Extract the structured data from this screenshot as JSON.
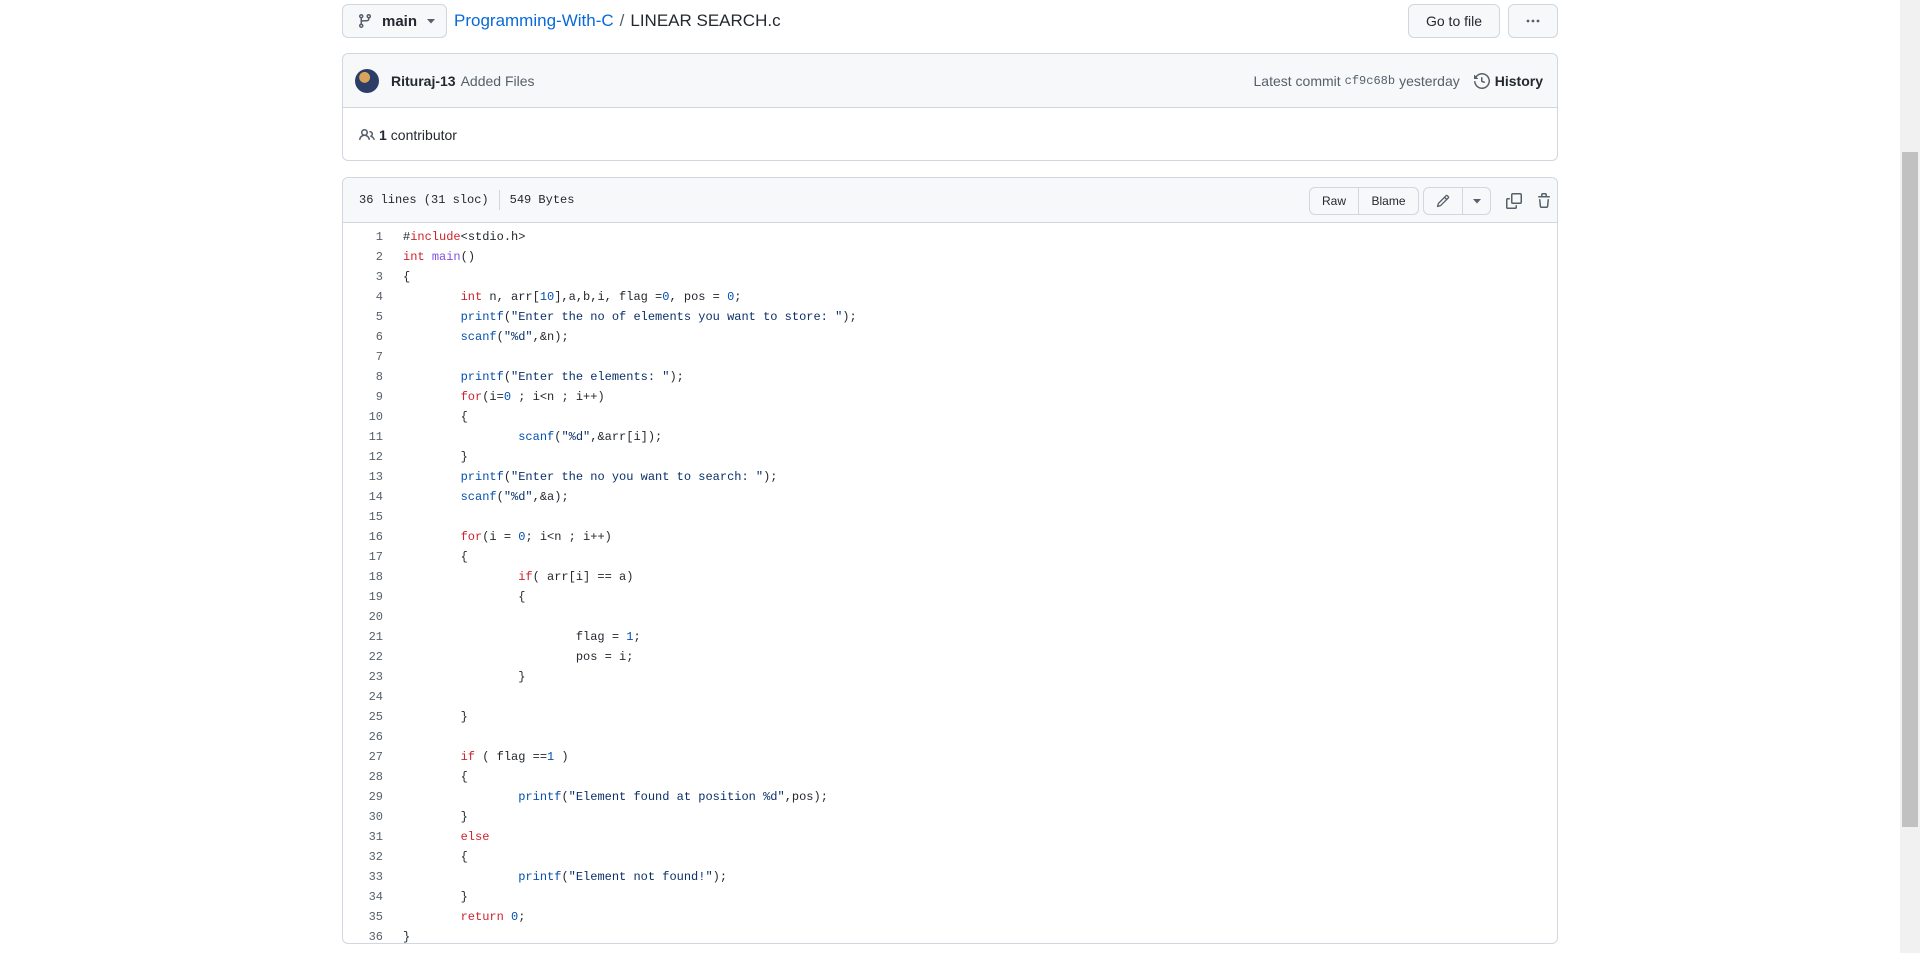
{
  "topbar": {
    "branch": "main",
    "repo": "Programming-With-C",
    "separator": "/",
    "file": "LINEAR SEARCH.c",
    "goto_label": "Go to file"
  },
  "commit": {
    "author": "Rituraj-13",
    "message": "Added Files",
    "latest_label": "Latest commit",
    "sha": "cf9c68b",
    "time": "yesterday",
    "history_label": "History"
  },
  "contributors": {
    "count": "1",
    "label": "contributor"
  },
  "file_info": {
    "lines": "36 lines (31 sloc)",
    "size": "549 Bytes",
    "raw_label": "Raw",
    "blame_label": "Blame"
  },
  "code_lines": [
    "#include<stdio.h>",
    "int main()",
    "{",
    "\tint n, arr[10],a,b,i, flag =0, pos = 0;",
    "\tprintf(\"Enter the no of elements you want to store: \");",
    "\tscanf(\"%d\",&n);",
    "",
    "\tprintf(\"Enter the elements: \");",
    "\tfor(i=0 ; i<n ; i++)",
    "\t{",
    "\t\tscanf(\"%d\",&arr[i]);",
    "\t}",
    "\tprintf(\"Enter the no you want to search: \");",
    "\tscanf(\"%d\",&a);",
    "",
    "\tfor(i = 0; i<n ; i++)",
    "\t{",
    "\t\tif( arr[i] == a)",
    "\t\t{",
    "",
    "\t\t\tflag = 1;",
    "\t\t\tpos = i;",
    "\t\t}",
    "",
    "\t}",
    "",
    "\tif ( flag ==1 )",
    "\t{",
    "\t\tprintf(\"Element found at position %d\",pos);",
    "\t}",
    "\telse",
    "\t{",
    "\t\tprintf(\"Element not found!\");",
    "\t}",
    "\treturn 0;",
    "}"
  ],
  "icons": {
    "branch": "git-branch-icon",
    "caret": "triangle-down-icon",
    "more": "kebab-horizontal-icon",
    "history": "history-icon",
    "people": "people-icon",
    "edit": "pencil-icon",
    "copy": "copy-icon",
    "delete": "trash-icon"
  },
  "colors": {
    "link": "#0969da",
    "keyword": "#cf222e",
    "function": "#8250df",
    "string": "#0a3069",
    "number": "#0550ae",
    "border": "#d0d7de",
    "header_bg": "#f6f8fa"
  }
}
